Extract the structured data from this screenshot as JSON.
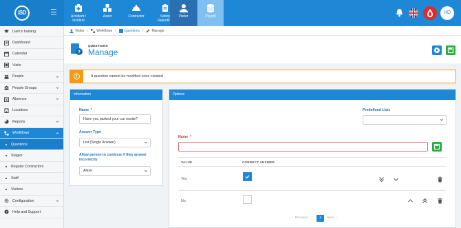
{
  "topbar": {
    "logo_text": "iSD",
    "modules": [
      {
        "label_line1": "Accident /",
        "label_line2": "Incident",
        "icon": "accident-icon"
      },
      {
        "label_line1": "Asset",
        "label_line2": "",
        "icon": "asset-icon"
      },
      {
        "label_line1": "Contractor",
        "label_line2": "",
        "icon": "contractor-icon"
      },
      {
        "label_line1": "Safety",
        "label_line2": "Reporting",
        "icon": "safety-icon"
      },
      {
        "label_line1": "Visitor",
        "label_line2": "",
        "icon": "visitor-icon"
      },
      {
        "label_line1": "Payroll",
        "label_line2": "",
        "icon": "payroll-icon"
      }
    ],
    "avatar_initials": "HD",
    "icons": [
      "bell-icon",
      "uk-flag-icon",
      "blood-drop-icon"
    ]
  },
  "sidebar": {
    "items": [
      {
        "label": "Liam's training",
        "icon": "graduation-icon"
      },
      {
        "label": "Dashboard",
        "icon": "dashboard-icon"
      },
      {
        "label": "Calendar",
        "icon": "calendar-icon"
      },
      {
        "label": "Visits",
        "icon": "visits-icon"
      },
      {
        "label": "People",
        "icon": "people-icon"
      },
      {
        "label": "People Groups",
        "icon": "people-groups-icon"
      },
      {
        "label": "Absence",
        "icon": "absence-icon"
      },
      {
        "label": "Locations",
        "icon": "locations-icon"
      },
      {
        "label": "Reports",
        "icon": "reports-icon"
      },
      {
        "label": "Workflows",
        "icon": "workflows-icon"
      },
      {
        "label": "Questions",
        "icon": ""
      },
      {
        "label": "Stages",
        "icon": ""
      },
      {
        "label": "Regular Contractors",
        "icon": ""
      },
      {
        "label": "Staff",
        "icon": ""
      },
      {
        "label": "Visitors",
        "icon": ""
      },
      {
        "label": "Configuration",
        "icon": "configuration-icon"
      },
      {
        "label": "Help and Support",
        "icon": "help-icon"
      }
    ]
  },
  "breadcrumb": [
    "Visitor",
    "Workflows",
    "Questions",
    "Manage"
  ],
  "header": {
    "eyebrow": "QUESTIONS",
    "title": "Manage"
  },
  "alert": {
    "text": "A question cannot be modified once created"
  },
  "information": {
    "panel_title": "Information",
    "name_label": "Name",
    "name_value": "Have you parked your car onsite?",
    "answer_type_label": "Answer Type",
    "answer_type_value": "List (Single Answer)",
    "allow_label_line1": "Allow person to continue if they answer",
    "allow_label_line2": "incorrectly",
    "allow_value": "Allow"
  },
  "options": {
    "panel_title": "Options",
    "predefined_label": "Predefined Lists",
    "predefined_value": "",
    "name_label": "Name",
    "name_value": "",
    "columns": [
      "VALUE",
      "CORRECT ANSWER"
    ],
    "rows": [
      {
        "value": "Yes",
        "correct": true
      },
      {
        "value": "No",
        "correct": false
      }
    ],
    "pager": {
      "previous": "Previous",
      "page": "1",
      "next": "Next"
    }
  },
  "colors": {
    "primary": "#1e88d6",
    "success": "#27ae3e",
    "warning": "#f39c12",
    "danger": "#e03030"
  }
}
